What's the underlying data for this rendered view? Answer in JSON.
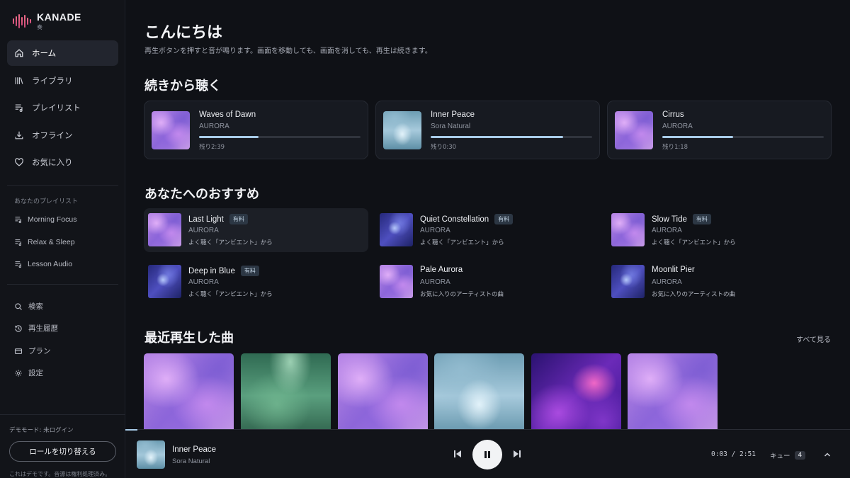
{
  "brand": {
    "name": "KANADE",
    "sub": "奏"
  },
  "nav": [
    {
      "label": "ホーム",
      "icon": "home-icon",
      "active": true
    },
    {
      "label": "ライブラリ",
      "icon": "library-icon"
    },
    {
      "label": "プレイリスト",
      "icon": "playlist-icon"
    },
    {
      "label": "オフライン",
      "icon": "download-icon"
    },
    {
      "label": "お気に入り",
      "icon": "heart-icon"
    }
  ],
  "playlists_section": {
    "label": "あなたのプレイリスト",
    "items": [
      "Morning Focus",
      "Relax & Sleep",
      "Lesson Audio"
    ]
  },
  "utility_nav": [
    {
      "label": "検索",
      "icon": "search-icon"
    },
    {
      "label": "再生履歴",
      "icon": "history-icon"
    },
    {
      "label": "プラン",
      "icon": "card-icon"
    },
    {
      "label": "設定",
      "icon": "gear-icon"
    }
  ],
  "sidebar_footer": {
    "demo_status": "デモモード: 未ログイン",
    "role_button": "ロールを切り替える",
    "note": "これはデモです。音源は権利処理済み。"
  },
  "main": {
    "greeting": "こんにちは",
    "greeting_sub": "再生ボタンを押すと音が鳴ります。画面を移動しても、画面を消しても、再生は続きます。",
    "continue_heading": "続きから聴く",
    "continue": [
      {
        "title": "Waves of Dawn",
        "artist": "AURORA",
        "progress": 0.37,
        "remaining": "残り2:39",
        "art": "purple"
      },
      {
        "title": "Inner Peace",
        "artist": "Sora Natural",
        "progress": 0.82,
        "remaining": "残り0:30",
        "art": "ice"
      },
      {
        "title": "Cirrus",
        "artist": "AURORA",
        "progress": 0.44,
        "remaining": "残り1:18",
        "art": "purple"
      }
    ],
    "recommend_heading": "あなたへのおすすめ",
    "recommendations": [
      {
        "title": "Last Light",
        "badge": "有料",
        "artist": "AURORA",
        "reason": "よく聴く「アンビエント」から",
        "art": "purple"
      },
      {
        "title": "Quiet Constellation",
        "badge": "有料",
        "artist": "AURORA",
        "reason": "よく聴く「アンビエント」から",
        "art": "blue"
      },
      {
        "title": "Slow Tide",
        "badge": "有料",
        "artist": "AURORA",
        "reason": "よく聴く「アンビエント」から",
        "art": "purple"
      },
      {
        "title": "Deep in Blue",
        "badge": "有料",
        "artist": "AURORA",
        "reason": "よく聴く「アンビエント」から",
        "art": "blue"
      },
      {
        "title": "Pale Aurora",
        "badge": "",
        "artist": "AURORA",
        "reason": "お気に入りのアーティストの曲",
        "art": "purple"
      },
      {
        "title": "Moonlit Pier",
        "badge": "",
        "artist": "AURORA",
        "reason": "お気に入りのアーティストの曲",
        "art": "blue"
      }
    ],
    "recent_heading": "最近再生した曲",
    "see_all": "すべて見る",
    "recent": [
      "purple",
      "green",
      "purple",
      "ice",
      "magenta",
      "purple"
    ]
  },
  "player": {
    "title": "Inner Peace",
    "artist": "Sora Natural",
    "time": "0:03 / 2:51",
    "queue_label": "キュー",
    "queue_count": "4",
    "progress": 0.02,
    "state": "playing",
    "art": "ice"
  },
  "colors": {
    "accent": "#a8cbe8",
    "background": "#0f1116",
    "sidebar": "#121419",
    "brand": "#e0557f"
  }
}
